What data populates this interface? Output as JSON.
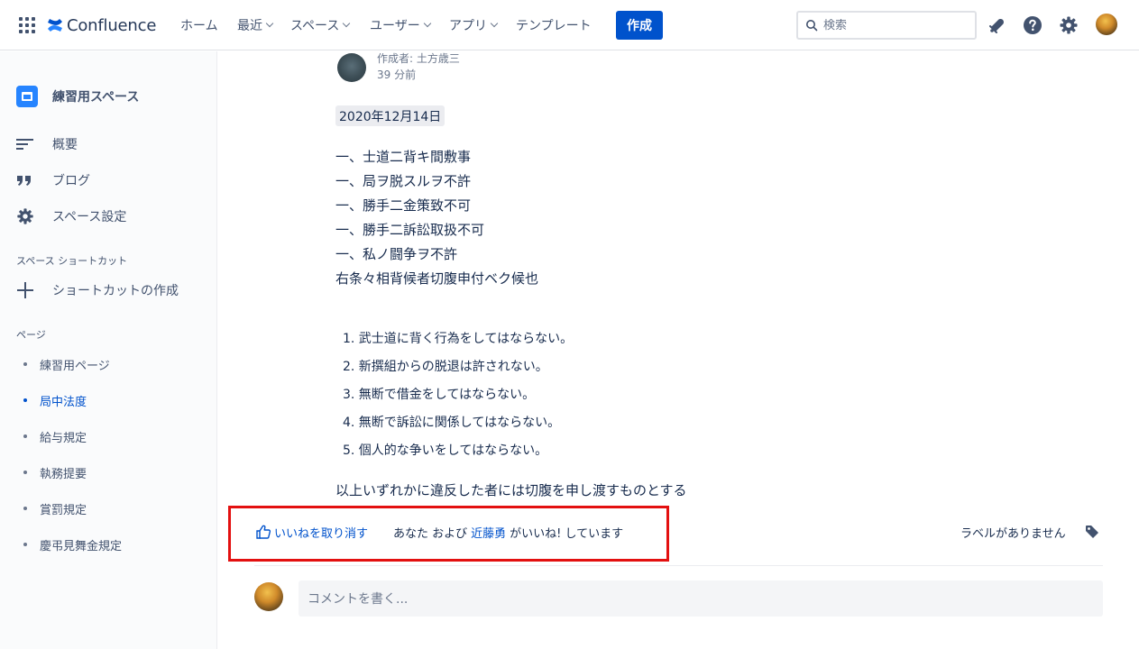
{
  "topnav": {
    "logo_text": "Confluence",
    "items": [
      {
        "label": "ホーム"
      },
      {
        "label": "最近"
      },
      {
        "label": "スペース"
      },
      {
        "label": "ユーザー"
      },
      {
        "label": "アプリ"
      },
      {
        "label": "テンプレート"
      }
    ],
    "create_label": "作成",
    "search_placeholder": "検索",
    "icons": [
      "apps-grid-icon",
      "notifications-icon",
      "help-icon",
      "settings-icon",
      "profile-avatar"
    ]
  },
  "sidebar": {
    "space_name": "練習用スペース",
    "nav": [
      {
        "label": "概要",
        "icon": "overview-icon"
      },
      {
        "label": "ブログ",
        "icon": "quote-icon"
      },
      {
        "label": "スペース設定",
        "icon": "gear-icon"
      }
    ],
    "shortcuts_heading": "スペース ショートカット",
    "create_shortcut_label": "ショートカットの作成",
    "pages_heading": "ページ",
    "pages": [
      {
        "label": "練習用ページ",
        "active": false
      },
      {
        "label": "局中法度",
        "active": true
      },
      {
        "label": "給与規定",
        "active": false
      },
      {
        "label": "執務提要",
        "active": false
      },
      {
        "label": "賞罰規定",
        "active": false
      },
      {
        "label": "慶弔見舞金規定",
        "active": false
      }
    ]
  },
  "content": {
    "author": "作成者: 土方歳三",
    "time": "39 分前",
    "date": "2020年12月14日",
    "original_lines": [
      "一、士道二背キ間敷事",
      "一、局ヲ脱スルヲ不許",
      "一、勝手二金策致不可",
      "一、勝手二訴訟取扱不可",
      "一、私ノ闘争ヲ不許",
      "右条々相背候者切腹申付ベク候也"
    ],
    "numbered": [
      "1. 武士道に背く行為をしてはならない。",
      "2. 新撰組からの脱退は許されない。",
      "3. 無断で借金をしてはならない。",
      "4. 無断で訴訟に関係してはならない。",
      "5. 個人的な争いをしてはならない。"
    ],
    "closing": "以上いずれかに違反した者には切腹を申し渡すものとする"
  },
  "likes": {
    "unlike_label": "いいねを取り消す",
    "prefix": "あなた および",
    "user": "近藤勇",
    "suffix": "がいいね! しています",
    "no_labels": "ラベルがありません",
    "highlight_color": "#e31010"
  },
  "comment": {
    "placeholder": "コメントを書く..."
  },
  "colors": {
    "brand": "#0052cc",
    "text": "#172b4d",
    "subtle": "#6b778c"
  }
}
